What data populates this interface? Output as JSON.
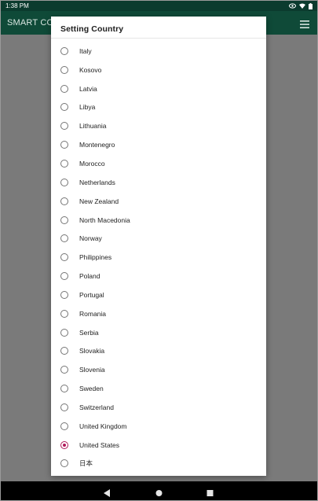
{
  "status_bar": {
    "time": "1:38 PM"
  },
  "app_bar": {
    "title": "SMART CON"
  },
  "dialog": {
    "title": "Setting Country",
    "options": [
      {
        "label": "Italy",
        "selected": false
      },
      {
        "label": "Kosovo",
        "selected": false
      },
      {
        "label": "Latvia",
        "selected": false
      },
      {
        "label": "Libya",
        "selected": false
      },
      {
        "label": "Lithuania",
        "selected": false
      },
      {
        "label": "Montenegro",
        "selected": false
      },
      {
        "label": "Morocco",
        "selected": false
      },
      {
        "label": "Netherlands",
        "selected": false
      },
      {
        "label": "New Zealand",
        "selected": false
      },
      {
        "label": "North Macedonia",
        "selected": false
      },
      {
        "label": "Norway",
        "selected": false
      },
      {
        "label": "Philippines",
        "selected": false
      },
      {
        "label": "Poland",
        "selected": false
      },
      {
        "label": "Portugal",
        "selected": false
      },
      {
        "label": "Romania",
        "selected": false
      },
      {
        "label": "Serbia",
        "selected": false
      },
      {
        "label": "Slovakia",
        "selected": false
      },
      {
        "label": "Slovenia",
        "selected": false
      },
      {
        "label": "Sweden",
        "selected": false
      },
      {
        "label": "Switzerland",
        "selected": false
      },
      {
        "label": "United Kingdom",
        "selected": false
      },
      {
        "label": "United States",
        "selected": true
      },
      {
        "label": "日本",
        "selected": false
      }
    ]
  },
  "icons": {
    "status": [
      "eye-icon",
      "wifi-icon",
      "battery-icon"
    ],
    "app_bar": "menu-icon",
    "nav": [
      "back-icon",
      "home-icon",
      "recents-icon"
    ]
  },
  "colors": {
    "status_bar": "#0b3b2e",
    "app_bar": "#0f4a38",
    "accent": "#b0185a",
    "scrim": "#7a7a7a"
  }
}
